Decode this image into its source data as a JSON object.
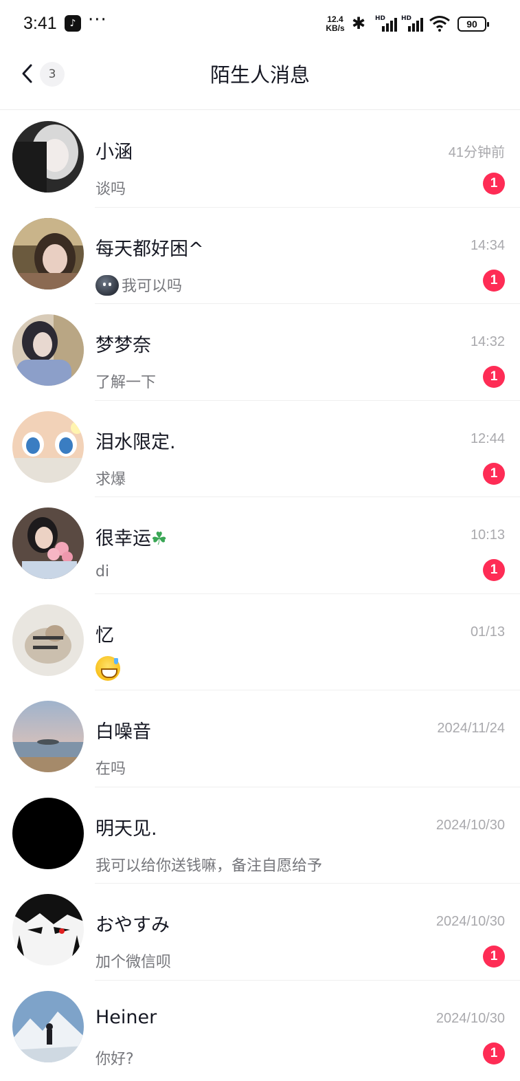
{
  "status_bar": {
    "time": "3:41",
    "app_icon": "tiktok-icon",
    "more": "···",
    "net_speed_value": "12.4",
    "net_speed_unit": "KB/s",
    "hd_label": "HD",
    "battery": "90"
  },
  "nav": {
    "back_icon": "chevron-left-icon",
    "back_count": "3",
    "title": "陌生人消息"
  },
  "conversations": [
    {
      "name": "小涵",
      "time": "41分钟前",
      "preview": "谈吗",
      "unread": "1"
    },
    {
      "name": "每天都好困^",
      "time": "14:34",
      "preview": "我可以吗",
      "unread": "1",
      "preview_emoji": "blob-emoji"
    },
    {
      "name": "梦梦奈",
      "time": "14:32",
      "preview": "了解一下",
      "unread": "1"
    },
    {
      "name": "泪水限定.",
      "time": "12:44",
      "preview": "求爆",
      "unread": "1"
    },
    {
      "name": "很幸运",
      "time": "10:13",
      "preview": "di",
      "unread": "1",
      "name_emoji": "clover-emoji"
    },
    {
      "name": "忆",
      "time": "01/13",
      "preview": "",
      "preview_emoji": "grinning-sweat-emoji"
    },
    {
      "name": "白噪音",
      "time": "2024/11/24",
      "preview": "在吗"
    },
    {
      "name": "明天见.",
      "time": "2024/10/30",
      "preview": "我可以给你送钱嘛，备注自愿给予"
    },
    {
      "name": "おやすみ",
      "time": "2024/10/30",
      "preview": "加个微信呗",
      "unread": "1"
    },
    {
      "name": "Heiner",
      "time": "2024/10/30",
      "preview": "你好?",
      "unread": "1"
    }
  ],
  "colors": {
    "badge": "#fe2c55",
    "time_text": "#a9a9ad",
    "preview_text": "#75767b",
    "divider": "#efefef"
  }
}
